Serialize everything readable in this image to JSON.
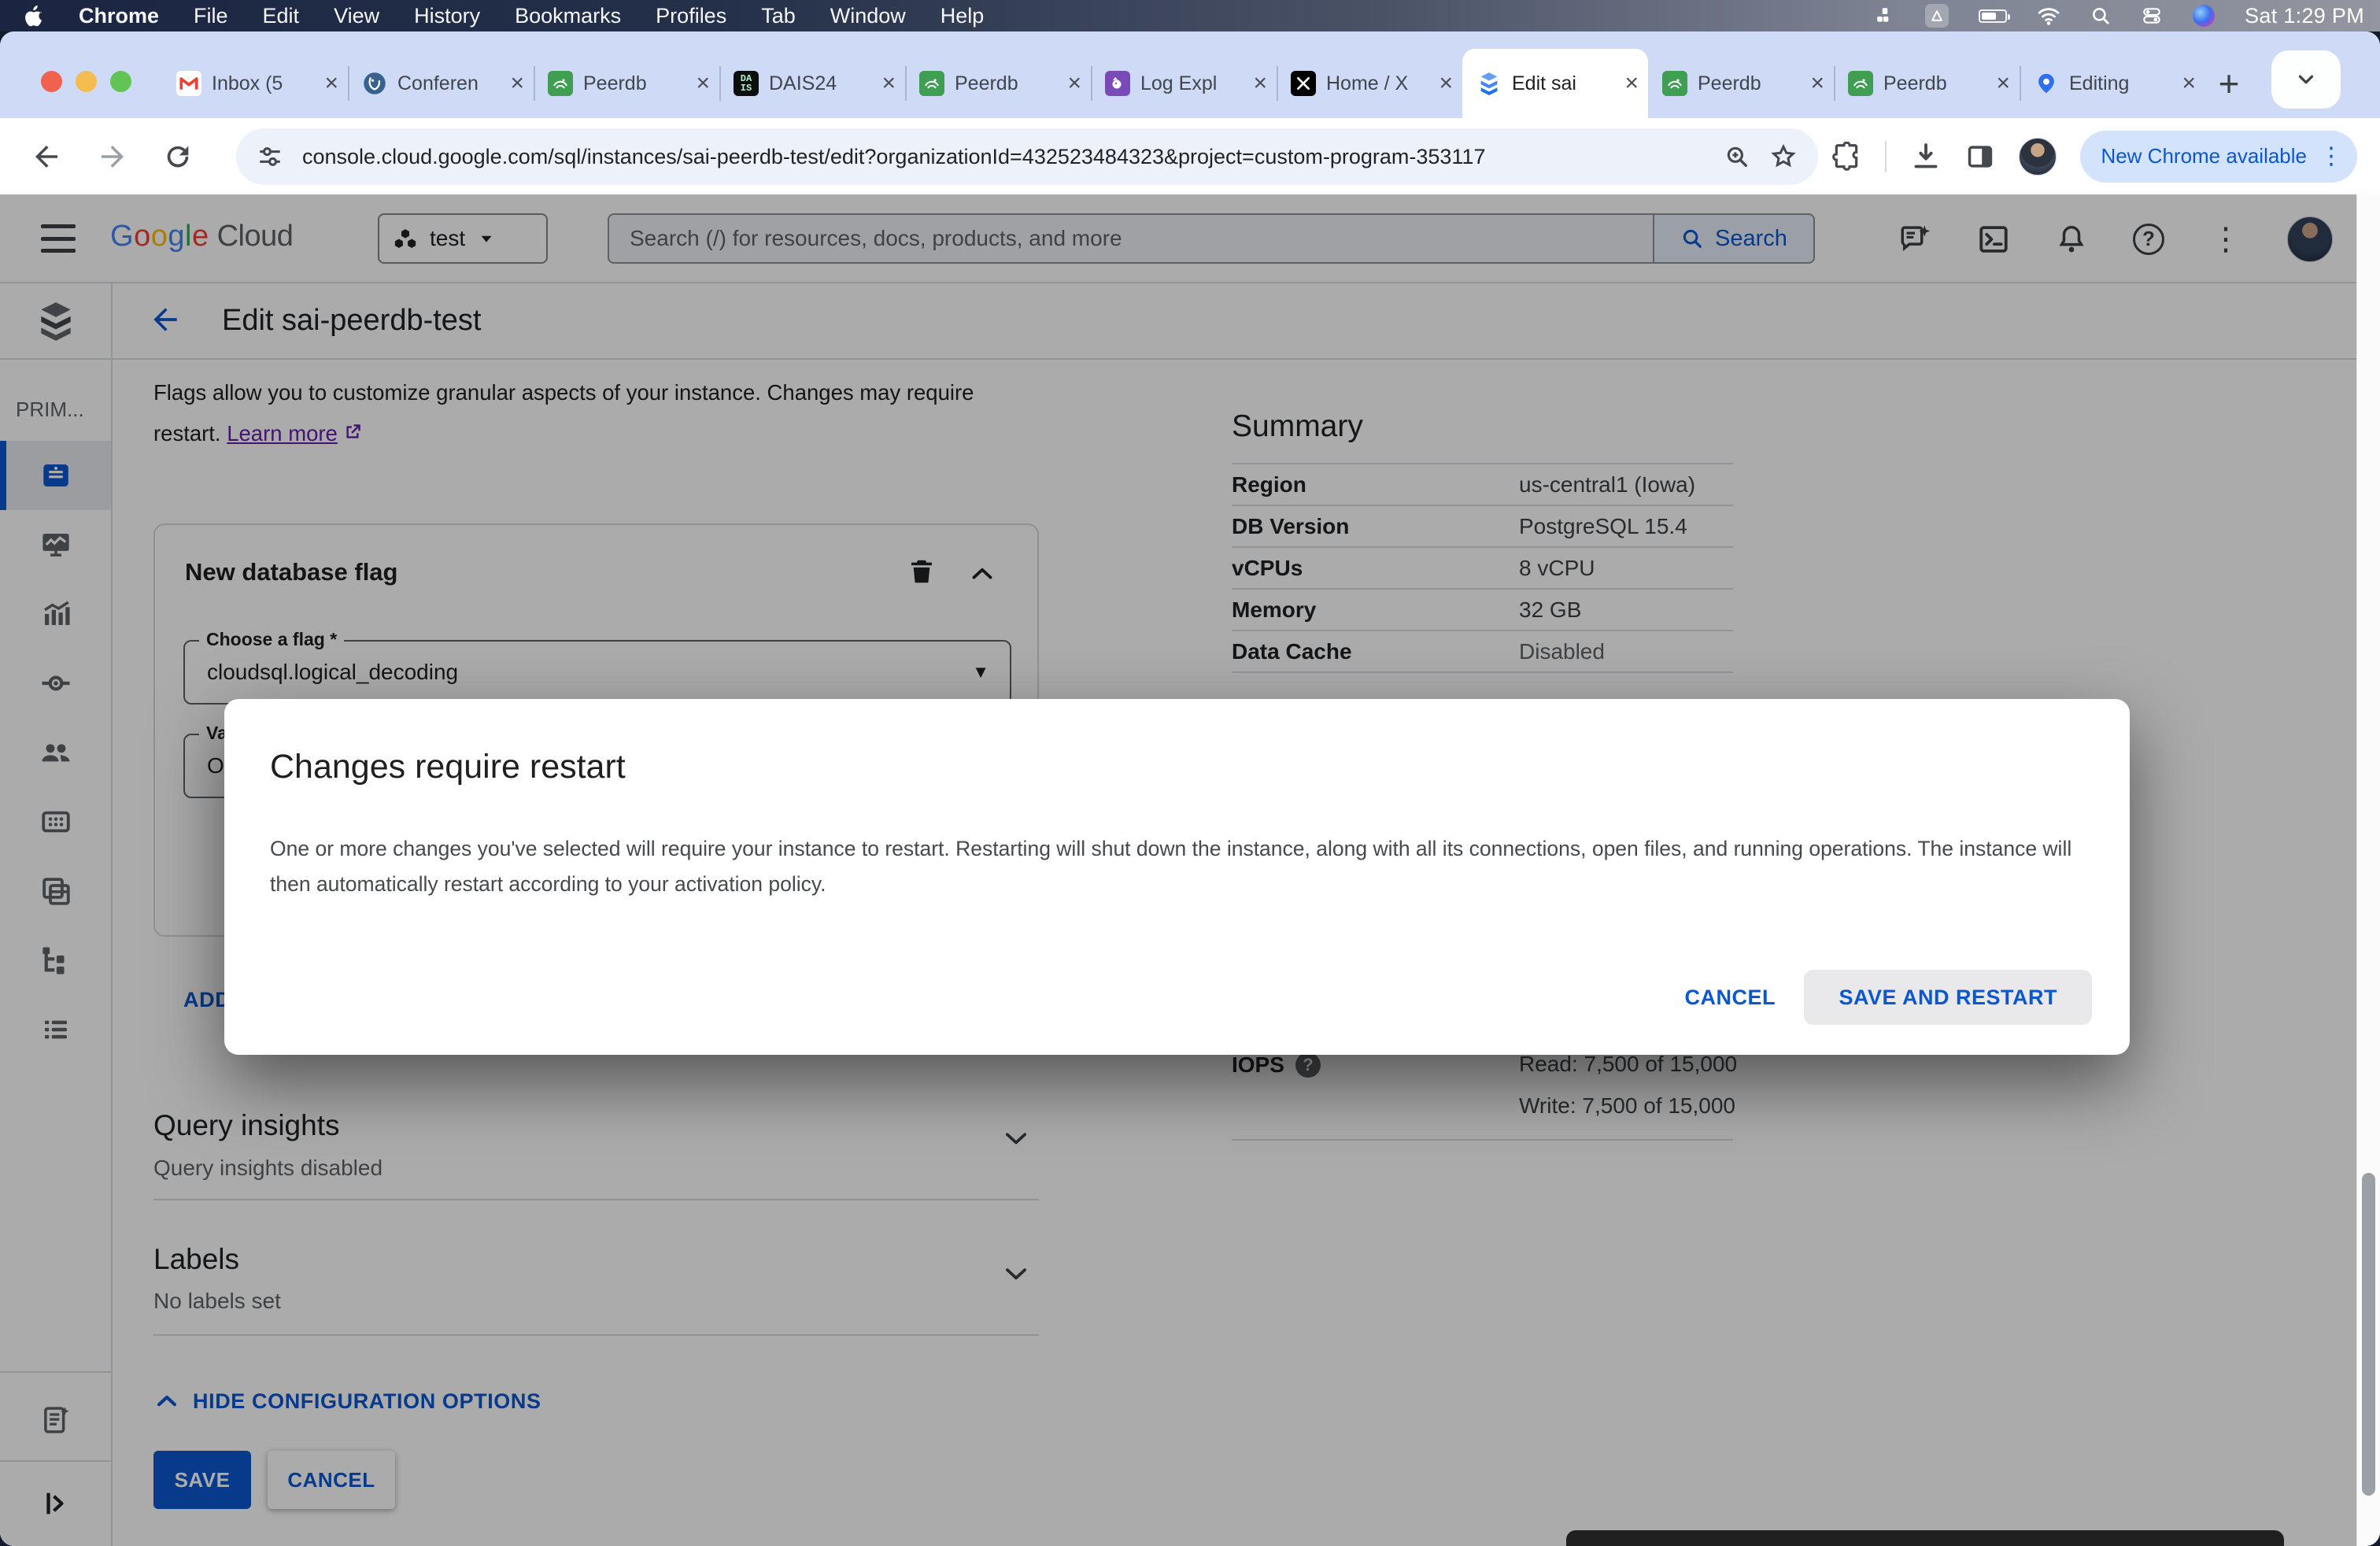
{
  "menubar": {
    "items": [
      "Chrome",
      "File",
      "Edit",
      "View",
      "History",
      "Bookmarks",
      "Profiles",
      "Tab",
      "Window",
      "Help"
    ],
    "clock": "Sat 1:29 PM"
  },
  "tabs": [
    {
      "title": "Inbox (5"
    },
    {
      "title": "Conferen"
    },
    {
      "title": "Peerdb"
    },
    {
      "title": "DAIS24"
    },
    {
      "title": "Peerdb"
    },
    {
      "title": "Log Expl"
    },
    {
      "title": "Home / X"
    },
    {
      "title": "Edit sai"
    },
    {
      "title": "Peerdb"
    },
    {
      "title": "Peerdb"
    },
    {
      "title": "Editing"
    }
  ],
  "favicons": {
    "dais_top": "DA",
    "dais_bottom": "IS"
  },
  "toolbar": {
    "url": "console.cloud.google.com/sql/instances/sai-peerdb-test/edit?organizationId=432523484323&project=custom-program-353117",
    "new_chrome": "New Chrome available"
  },
  "gcloud": {
    "logo_letters": [
      "G",
      "o",
      "o",
      "g",
      "l",
      "e"
    ],
    "logo_cloud": "Cloud",
    "project": "test",
    "search_placeholder": "Search (/) for resources, docs, products, and more",
    "search_button": "Search",
    "help_glyph": "?"
  },
  "sidebar": {
    "group_label": "PRIM..."
  },
  "page": {
    "title": "Edit sai-peerdb-test",
    "flags_text": "Flags allow you to customize granular aspects of your instance. Changes may require restart.",
    "learn_more": "Learn more"
  },
  "card": {
    "title": "New database flag",
    "flag_label": "Choose a flag *",
    "flag_value": "cloudsql.logical_decoding",
    "value_label": "Value",
    "value_value": "On",
    "add_label": "ADD"
  },
  "sections": {
    "query_insights_title": "Query insights",
    "query_insights_sub": "Query insights disabled",
    "labels_title": "Labels",
    "labels_sub": "No labels set",
    "hide_config": "HIDE CONFIGURATION OPTIONS",
    "save": "SAVE",
    "cancel": "CANCEL"
  },
  "summary": {
    "title": "Summary",
    "rows": [
      {
        "label": "Region",
        "value": "us-central1 (Iowa)"
      },
      {
        "label": "DB Version",
        "value": "PostgreSQL 15.4"
      },
      {
        "label": "vCPUs",
        "value": "8 vCPU"
      },
      {
        "label": "Memory",
        "value": "32 GB"
      },
      {
        "label": "Data Cache",
        "value": "Disabled"
      }
    ],
    "iops_label": "IOPS",
    "iops_read": "Read: 7,500 of 15,000",
    "iops_write": "Write: 7,500 of 15,000"
  },
  "modal": {
    "title": "Changes require restart",
    "body": "One or more changes you've selected will require your instance to restart. Restarting will shut down the instance, along with all its connections, open files, and running operations. The instance will then automatically restart according to your activation policy.",
    "cancel": "CANCEL",
    "confirm": "SAVE AND RESTART"
  },
  "colors": {
    "accent": "#0b57d0",
    "visited_link": "#681da8",
    "scrim": "rgba(0,0,0,0.33)",
    "tabstrip": "#cedaf6"
  }
}
